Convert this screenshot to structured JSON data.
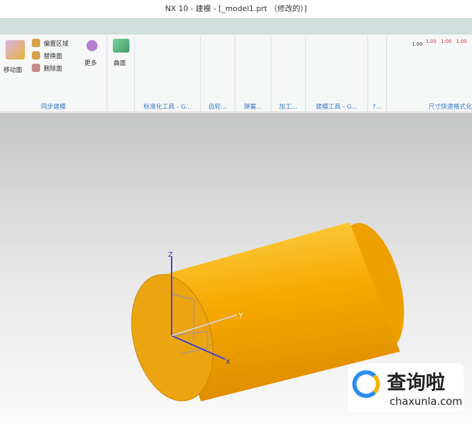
{
  "window": {
    "title": "NX 10 - 建模 - [_model1.prt （修改的）]"
  },
  "ribbon": {
    "sync": {
      "move_face": "移动面",
      "offset_region": "偏置区域",
      "replace_face": "替换面",
      "delete_face": "删除面",
      "more": "更多",
      "label": "同步建模"
    },
    "surface": {
      "label": "曲面"
    },
    "groups": [
      "标准化工具 - G...",
      "齿轮...",
      "弹簧...",
      "加工...",
      "建模工具 - G...",
      "?...",
      "尺寸快速格式化"
    ],
    "dim_values": [
      "1.00",
      "1.00",
      "1.00",
      "1.00"
    ]
  },
  "viewport": {
    "axes": {
      "x": "X",
      "y": "Y",
      "z": "Z"
    },
    "colors": {
      "model": "#f5a800"
    }
  },
  "watermark": {
    "brand": "查询啦",
    "url": "chaxunla.com"
  }
}
